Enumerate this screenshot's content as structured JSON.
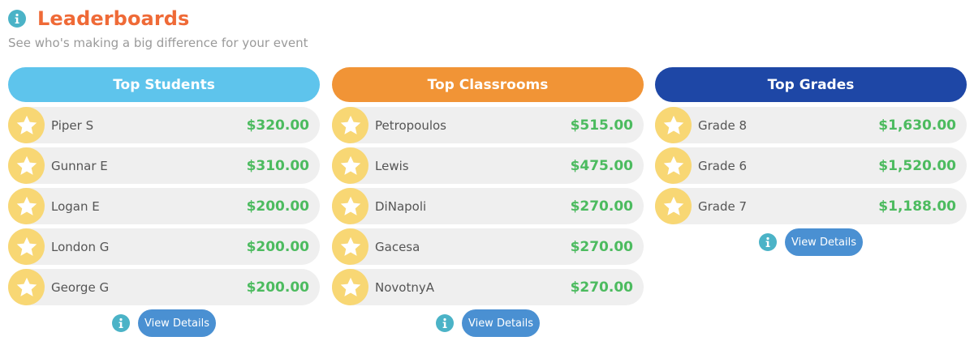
{
  "header": {
    "title": "Leaderboards",
    "subtitle": "See who's making a big difference for your event"
  },
  "colors": {
    "title": "#ef6a37",
    "students_header": "#5ec4ec",
    "classrooms_header": "#f19436",
    "grades_header": "#1e47a6",
    "amount": "#4cbb5f",
    "star_badge": "#f8d774",
    "info_icon": "#4bb3c7",
    "view_button": "#4a90d2"
  },
  "columns": [
    {
      "key": "students",
      "header": "Top Students",
      "rows": [
        {
          "name": "Piper S",
          "amount": "$320.00"
        },
        {
          "name": "Gunnar E",
          "amount": "$310.00"
        },
        {
          "name": "Logan E",
          "amount": "$200.00"
        },
        {
          "name": "London G",
          "amount": "$200.00"
        },
        {
          "name": "George G",
          "amount": "$200.00"
        }
      ],
      "view_details_label": "View Details"
    },
    {
      "key": "classrooms",
      "header": "Top Classrooms",
      "rows": [
        {
          "name": "Petropoulos",
          "amount": "$515.00"
        },
        {
          "name": "Lewis",
          "amount": "$475.00"
        },
        {
          "name": "DiNapoli",
          "amount": "$270.00"
        },
        {
          "name": "Gacesa",
          "amount": "$270.00"
        },
        {
          "name": "NovotnyA",
          "amount": "$270.00"
        }
      ],
      "view_details_label": "View Details"
    },
    {
      "key": "grades",
      "header": "Top Grades",
      "rows": [
        {
          "name": "Grade 8",
          "amount": "$1,630.00"
        },
        {
          "name": "Grade 6",
          "amount": "$1,520.00"
        },
        {
          "name": "Grade 7",
          "amount": "$1,188.00"
        }
      ],
      "view_details_label": "View Details"
    }
  ],
  "icons": {
    "info": "info-icon",
    "star": "star-icon"
  }
}
